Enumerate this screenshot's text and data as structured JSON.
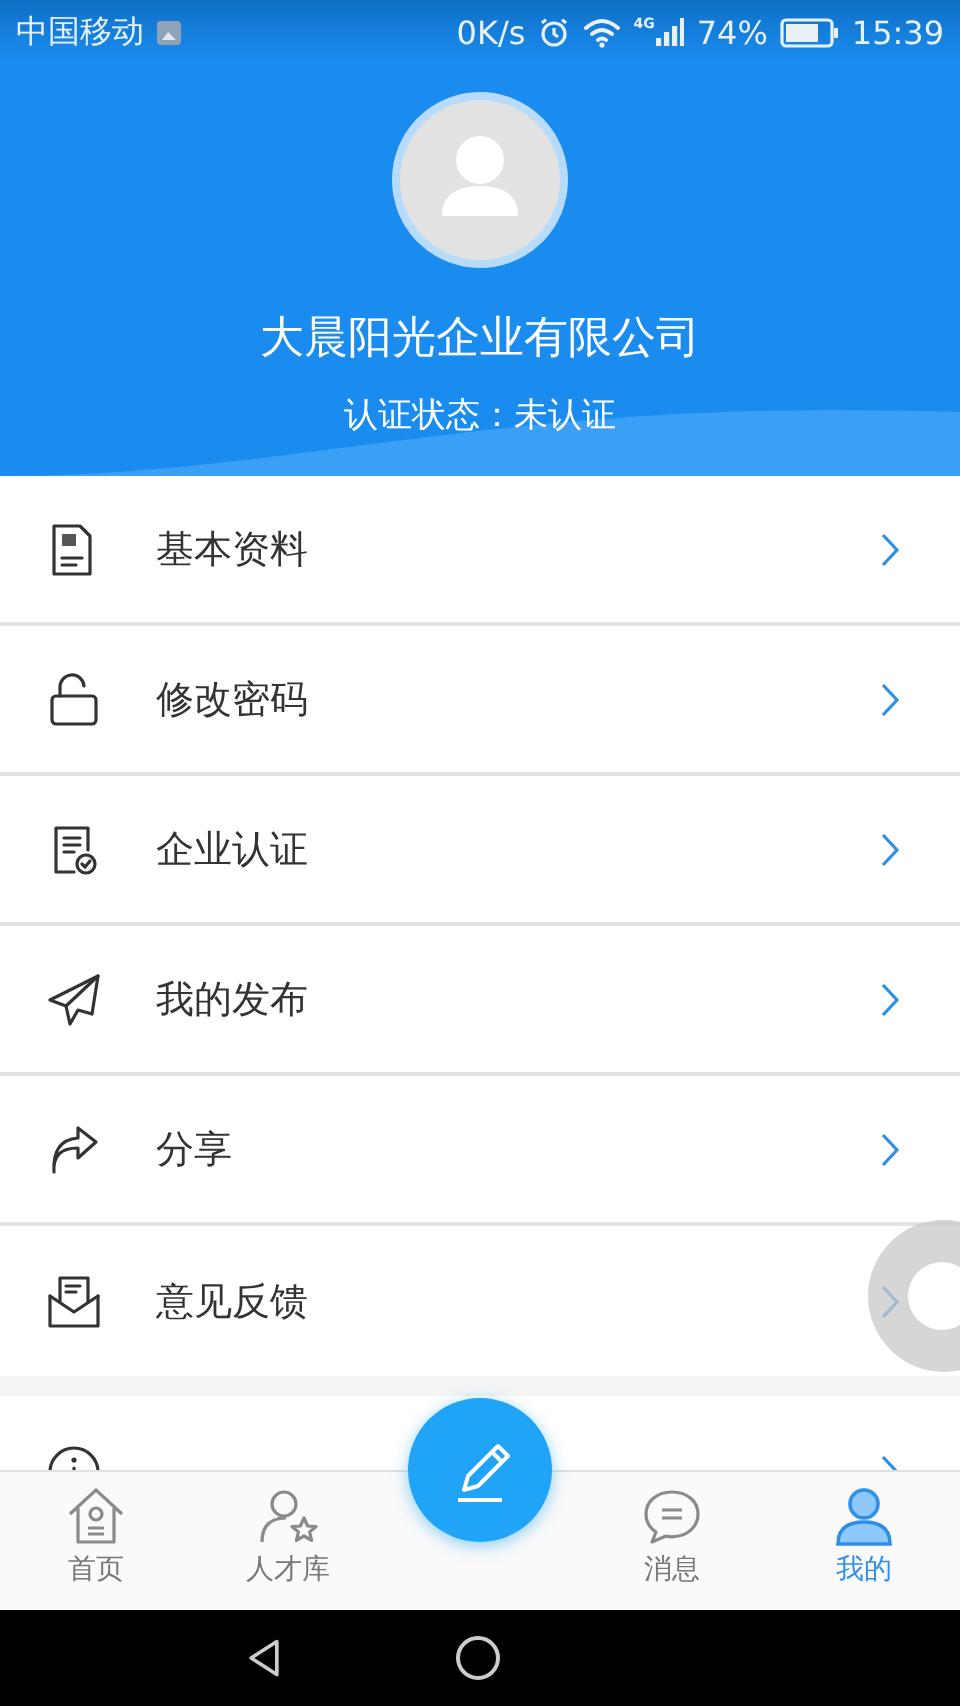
{
  "status_bar": {
    "carrier": "中国移动",
    "speed": "0K/s",
    "network": "4G",
    "battery": "74%",
    "time": "15:39"
  },
  "profile": {
    "name": "大晨阳光企业有限公司",
    "status": "认证状态：未认证"
  },
  "menu_groups": [
    [
      {
        "label": "基本资料",
        "kind": "document"
      },
      {
        "label": "修改密码",
        "kind": "lock"
      },
      {
        "label": "企业认证",
        "kind": "certificate"
      },
      {
        "label": "我的发布",
        "kind": "send"
      },
      {
        "label": "分享",
        "kind": "share"
      },
      {
        "label": "意见反馈",
        "kind": "mail"
      }
    ],
    [
      {
        "kind": "info"
      }
    ]
  ],
  "tabs": [
    {
      "label": "首页",
      "selected": false
    },
    {
      "label": "人才库",
      "selected": false
    },
    {
      "label": "消息",
      "selected": false
    },
    {
      "label": "我的",
      "selected": true
    }
  ]
}
